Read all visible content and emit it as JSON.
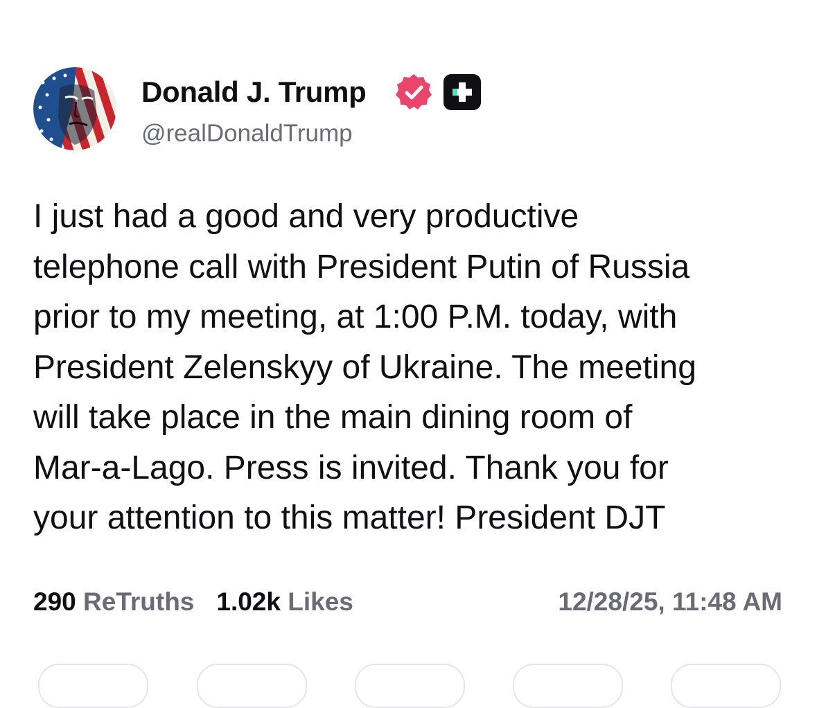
{
  "author": {
    "display_name": "Donald J. Trump",
    "handle": "@realDonaldTrump",
    "verified_icon": "verified-badge-icon",
    "plus_icon": "truth-plus-icon",
    "verified_color": "#e8466b",
    "plus_bg_color": "#0f0f14",
    "plus_accent_color": "#5be0b8"
  },
  "post": {
    "text": "I just had a good and very productive\ntelephone call with President Putin of Russia\nprior to my meeting, at 1:00 P.M. today, with\nPresident Zelenskyy of Ukraine. The meeting\nwill take place in the main dining room of\nMar-a-Lago. Press is invited. Thank you for\nyour attention to this matter! President DJT"
  },
  "stats": {
    "retruths_count": "290",
    "retruths_label": "ReTruths",
    "likes_count": "1.02k",
    "likes_label": "Likes"
  },
  "timestamp": "12/28/25, 11:48 AM",
  "colors": {
    "text_primary": "#0f0f14",
    "text_secondary": "#6b6b77",
    "background": "#ffffff",
    "pill_border": "#e6e6ea"
  }
}
